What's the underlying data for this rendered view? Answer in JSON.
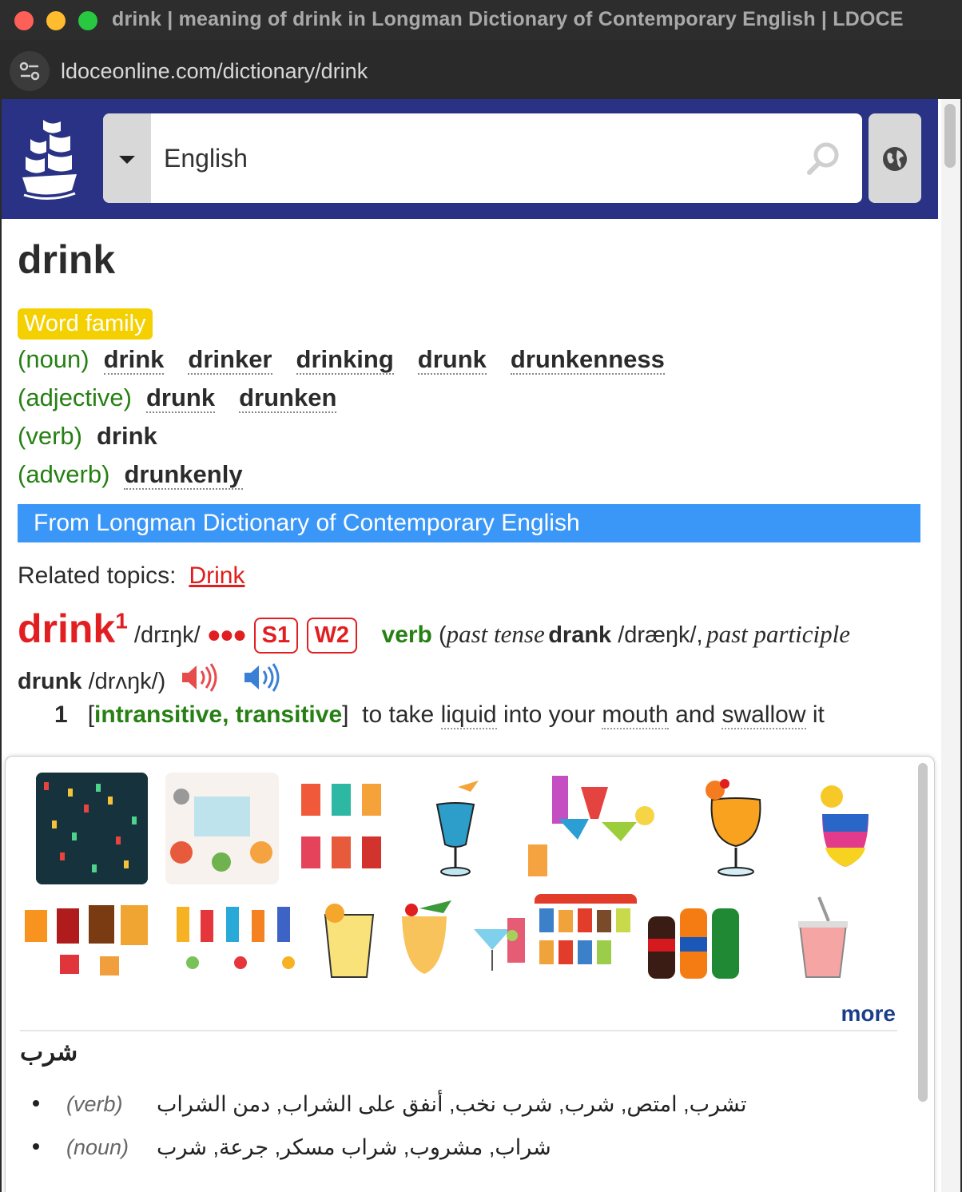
{
  "window": {
    "title": "drink | meaning of drink in Longman Dictionary of Contemporary English | LDOCE",
    "url": "ldoceonline.com/dictionary/drink"
  },
  "header": {
    "search_value": "English",
    "brand_color": "#293285"
  },
  "entry": {
    "headword": "drink",
    "word_family_label": "Word family",
    "word_family": [
      {
        "pos": "(noun)",
        "words": [
          "drink",
          "drinker",
          "drinking",
          "drunk",
          "drunkenness"
        ]
      },
      {
        "pos": "(adjective)",
        "words": [
          "drunk",
          "drunken"
        ]
      },
      {
        "pos": "(verb)",
        "words": [
          "drink"
        ]
      },
      {
        "pos": "(adverb)",
        "words": [
          "drunkenly"
        ]
      }
    ],
    "source_banner": "From Longman Dictionary of Contemporary English",
    "related_topics_label": "Related topics:",
    "related_topic": "Drink",
    "hw_red": "drink",
    "homnum": "1",
    "pron": " /drɪŋk/ ",
    "freq_dots": "●●●",
    "freq_s": "S1",
    "freq_w": "W2",
    "pos": "verb",
    "forms": {
      "open": " (",
      "past_tense_label": "past tense",
      "past_tense": "drank",
      "past_tense_pron": " /dræŋk/,",
      "past_participle_label": "past participle",
      "past_participle": "drunk",
      "past_participle_pron": " /drʌŋk/)"
    },
    "sense": {
      "num": "1",
      "grammar": "intransitive, transitive",
      "def_before": "to take ",
      "def_w1": "liquid",
      "def_mid": " into your ",
      "def_w2": "mouth",
      "def_mid2": " and ",
      "def_w3": "swallow",
      "def_end": " it"
    }
  },
  "popup": {
    "more_label": "more",
    "arabic_title": "شرب",
    "translations": [
      {
        "pos": "(verb)",
        "text": "تشرب, امتص, شرب, شرب نخب, أنفق على الشراب, دمن الشراب"
      },
      {
        "pos": "(noun)",
        "text": "شراب, مشروب, شراب مسكر, جرعة, شرب"
      }
    ]
  }
}
